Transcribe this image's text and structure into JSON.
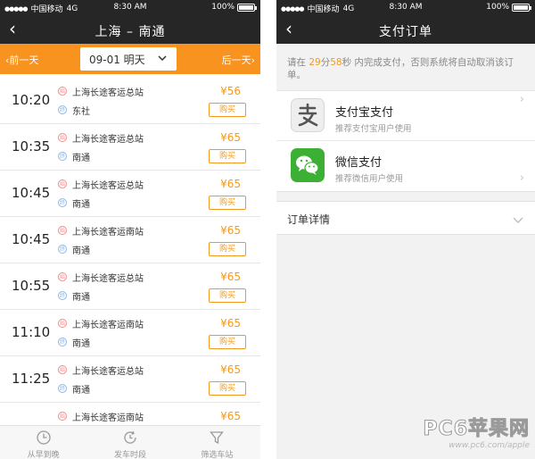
{
  "status": {
    "carrier": "中国移动",
    "network": "4G",
    "time": "8:30 AM",
    "battery": "100%",
    "battery_level": 1.0
  },
  "left": {
    "nav": {
      "title": "上海 – 南通"
    },
    "datebar": {
      "prev": "前一天",
      "date": "09-01 明天",
      "next": "后一天"
    },
    "tickets": [
      {
        "time": "10:20",
        "from_badge": "始",
        "from": "上海长途客运总站",
        "to_badge": "终",
        "to": "东社",
        "price": "¥56",
        "buy": "购买"
      },
      {
        "time": "10:35",
        "from_badge": "始",
        "from": "上海长途客运总站",
        "to_badge": "终",
        "to": "南通",
        "price": "¥65",
        "buy": "购买"
      },
      {
        "time": "10:45",
        "from_badge": "始",
        "from": "上海长途客运总站",
        "to_badge": "终",
        "to": "南通",
        "price": "¥65",
        "buy": "购买"
      },
      {
        "time": "10:45",
        "from_badge": "始",
        "from": "上海长途客运南站",
        "to_badge": "终",
        "to": "南通",
        "price": "¥65",
        "buy": "购买"
      },
      {
        "time": "10:55",
        "from_badge": "始",
        "from": "上海长途客运总站",
        "to_badge": "终",
        "to": "南通",
        "price": "¥65",
        "buy": "购买"
      },
      {
        "time": "11:10",
        "from_badge": "始",
        "from": "上海长途客运南站",
        "to_badge": "终",
        "to": "南通",
        "price": "¥65",
        "buy": "购买"
      },
      {
        "time": "11:25",
        "from_badge": "始",
        "from": "上海长途客运总站",
        "to_badge": "终",
        "to": "南通",
        "price": "¥65",
        "buy": "购买"
      },
      {
        "time": "",
        "from_badge": "始",
        "from": "上海长途客运南站",
        "to_badge": "",
        "to": "",
        "price": "¥65",
        "buy": ""
      }
    ],
    "tabs": [
      {
        "label": "从早到晚",
        "icon": "clock-icon"
      },
      {
        "label": "发车时段",
        "icon": "refresh-clock-icon"
      },
      {
        "label": "筛选车站",
        "icon": "filter-icon"
      }
    ]
  },
  "right": {
    "nav": {
      "title": "支付订单"
    },
    "tip": {
      "prefix": "请在 ",
      "minutes": "29",
      "min_unit": "分",
      "seconds": "58",
      "suffix": "秒 内完成支付，否则系统将自动取消该订单。"
    },
    "payments": [
      {
        "name": "支付宝支付",
        "desc": "推荐支付宝用户使用",
        "icon": "alipay-icon"
      },
      {
        "name": "微信支付",
        "desc": "推荐微信用户使用",
        "icon": "wechat-icon"
      }
    ],
    "detail": {
      "label": "订单详情"
    }
  },
  "watermark": {
    "brand": "PC6苹果网",
    "url": "www.pc6.com/apple"
  },
  "colors": {
    "accent": "#f7931e",
    "price": "#f39a1e",
    "dark_bar": "#262626",
    "wechat": "#3cb034"
  }
}
